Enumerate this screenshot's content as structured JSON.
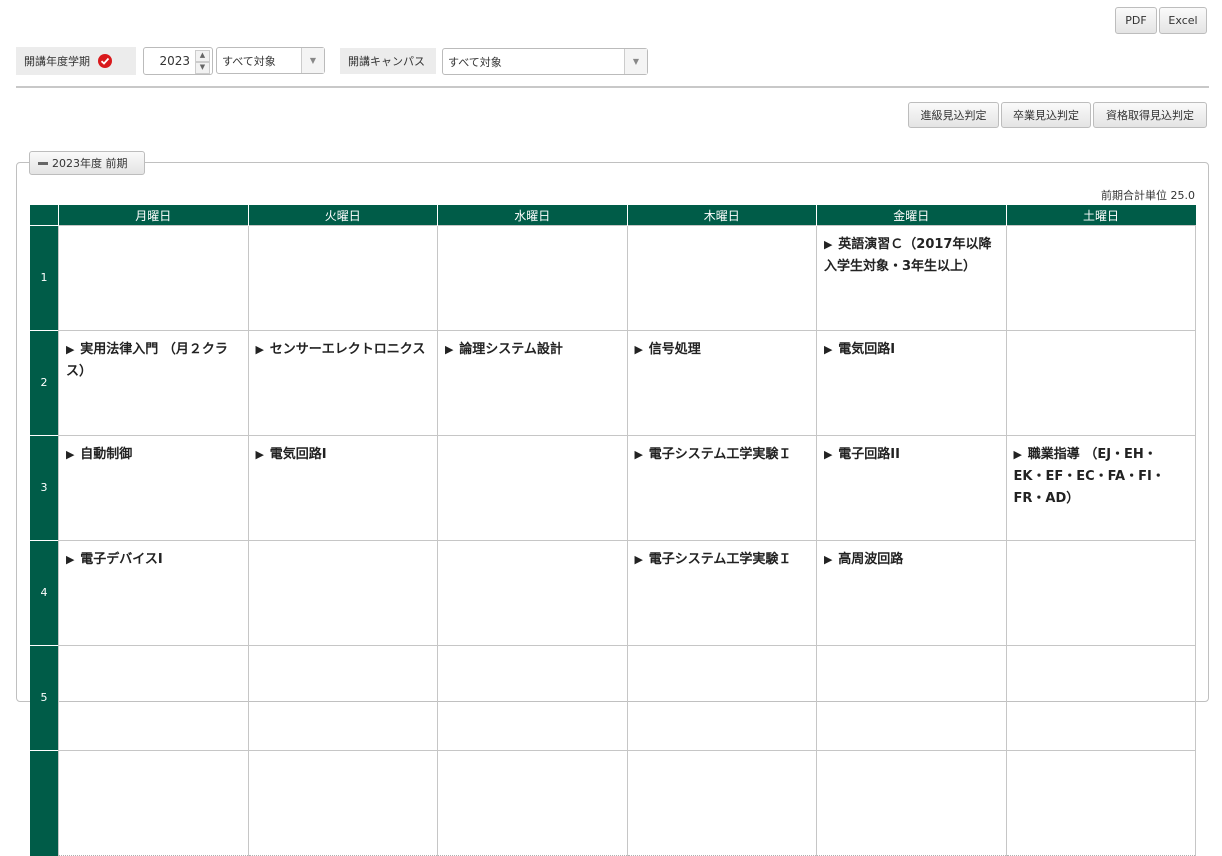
{
  "toolbar": {
    "pdf_label": "PDF",
    "excel_label": "Excel"
  },
  "filters": {
    "year_term_label": "開講年度学期",
    "year_value": "2023",
    "term_select": "すべて対象",
    "campus_label": "開講キャンパス",
    "campus_select": "すべて対象"
  },
  "judgement_buttons": [
    "進級見込判定",
    "卒業見込判定",
    "資格取得見込判定"
  ],
  "section": {
    "title": "2023年度 前期",
    "total_units": "前期合計単位 25.0"
  },
  "timetable": {
    "days": [
      "月曜日",
      "火曜日",
      "水曜日",
      "木曜日",
      "金曜日",
      "土曜日"
    ],
    "periods": [
      {
        "label": "1",
        "cells": [
          "",
          "",
          "",
          "",
          "英語演習Ｃ（2017年以降入学生対象・3年生以上）",
          ""
        ]
      },
      {
        "label": "2",
        "cells": [
          "実用法律入門 （月２クラス）",
          "センサーエレクトロニクス",
          "論理システム設計",
          "信号処理",
          "電気回路I",
          ""
        ]
      },
      {
        "label": "3",
        "cells": [
          "自動制御",
          "電気回路I",
          "",
          "電子システム工学実験Ｉ",
          "電子回路II",
          "職業指導 （EJ・EH・EK・EF・EC・FA・FI・FR・AD）"
        ]
      },
      {
        "label": "4",
        "cells": [
          "電子デバイスI",
          "",
          "",
          "電子システム工学実験Ｉ",
          "高周波回路",
          ""
        ]
      },
      {
        "label": "5",
        "cells": [
          "",
          "",
          "",
          "",
          "",
          ""
        ]
      },
      {
        "label": "",
        "cells": [
          "",
          "",
          "",
          "",
          "",
          ""
        ]
      }
    ]
  },
  "colors": {
    "header_green": "#005c48",
    "required_red": "#d9191c"
  },
  "icons": {
    "required": "check-circle-icon",
    "collapse": "minus-icon",
    "course": "triangle-right-icon"
  }
}
